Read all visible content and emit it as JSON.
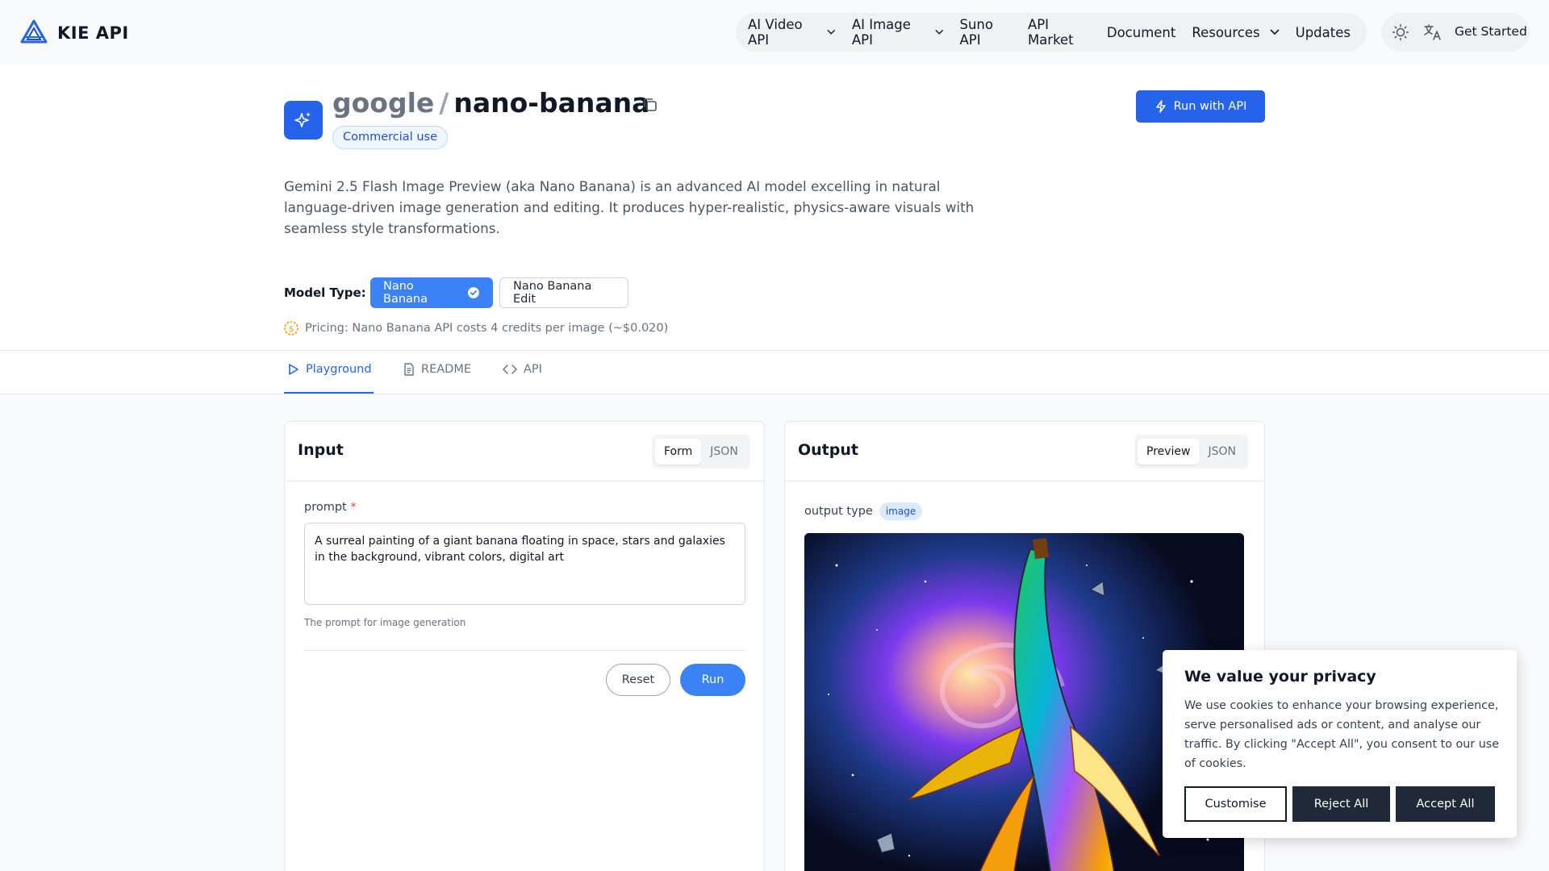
{
  "brand": {
    "name": "KIE API",
    "logo_icon": "kie-logo-icon"
  },
  "nav": {
    "items": [
      {
        "label": "AI Video API",
        "has_dropdown": true
      },
      {
        "label": "AI Image API",
        "has_dropdown": true
      },
      {
        "label": "Suno API",
        "has_dropdown": false
      },
      {
        "label": "API Market",
        "has_dropdown": false
      },
      {
        "label": "Document",
        "has_dropdown": false
      },
      {
        "label": "Resources",
        "has_dropdown": true
      },
      {
        "label": "Updates",
        "has_dropdown": false
      }
    ],
    "theme_icon": "sun-icon",
    "language_icon": "translate-icon",
    "get_started": "Get Started"
  },
  "model": {
    "owner": "google",
    "separator": "/",
    "name": "nano-banana",
    "badge": "Commercial use",
    "run_with_api": "Run with API",
    "description": "Gemini 2.5 Flash Image Preview (aka Nano Banana) is an advanced AI model excelling in natural language-driven image generation and editing. It produces hyper-realistic, physics-aware visuals with seamless style transformations.",
    "model_type_label": "Model Type:",
    "model_types": [
      "Nano Banana",
      "Nano Banana Edit"
    ],
    "selected_model_type": "Nano Banana",
    "pricing": "Pricing: Nano Banana API costs 4 credits per image (~$0.020)"
  },
  "tabs": [
    {
      "label": "Playground",
      "icon": "play-icon",
      "active": true
    },
    {
      "label": "README",
      "icon": "document-icon",
      "active": false
    },
    {
      "label": "API",
      "icon": "code-icon",
      "active": false
    }
  ],
  "input_panel": {
    "title": "Input",
    "modes": [
      "Form",
      "JSON"
    ],
    "active_mode": "Form",
    "prompt_label": "prompt",
    "required_marker": "*",
    "prompt_value": "A surreal painting of a giant banana floating in space, stars and galaxies in the background, vibrant colors, digital art",
    "prompt_help": "The prompt for image generation",
    "reset_label": "Reset",
    "run_label": "Run"
  },
  "output_panel": {
    "title": "Output",
    "modes": [
      "Preview",
      "JSON"
    ],
    "active_mode": "Preview",
    "output_type_label": "output type",
    "output_type_value": "image"
  },
  "cookie": {
    "title": "We value your privacy",
    "text": "We use cookies to enhance your browsing experience, serve personalised ads or content, and analyse our traffic. By clicking \"Accept All\", you consent to our use of cookies.",
    "customise": "Customise",
    "reject": "Reject All",
    "accept": "Accept All"
  },
  "colors": {
    "accent": "#2563eb",
    "accent_light": "#3b82f6",
    "dark_button": "#1f2937"
  }
}
